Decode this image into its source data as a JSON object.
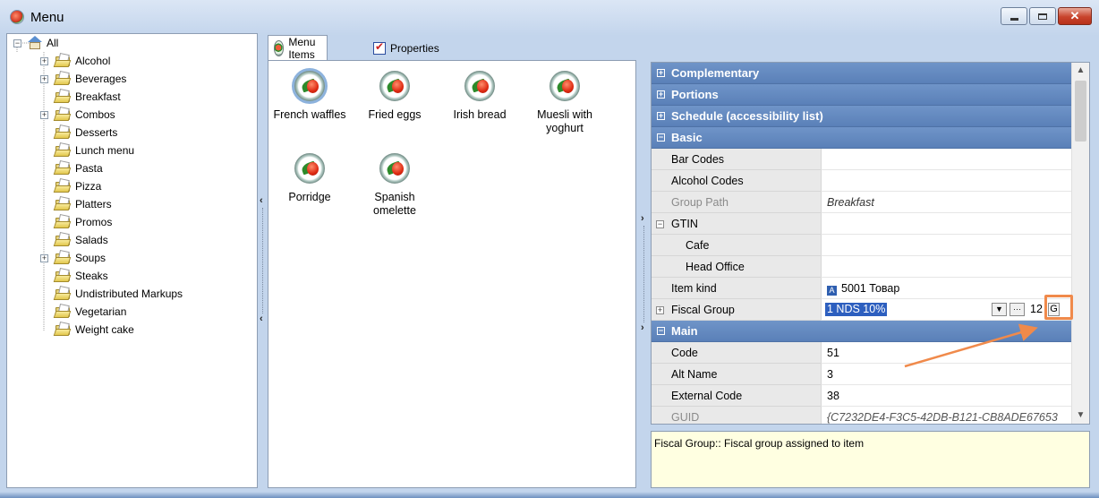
{
  "window": {
    "title": "Menu",
    "close_glyph": "✕"
  },
  "tree": {
    "root": "All",
    "items": [
      {
        "label": "Alcohol",
        "expandable": true
      },
      {
        "label": "Beverages",
        "expandable": true
      },
      {
        "label": "Breakfast",
        "expandable": false
      },
      {
        "label": "Combos",
        "expandable": true
      },
      {
        "label": "Desserts",
        "expandable": false
      },
      {
        "label": "Lunch menu",
        "expandable": false
      },
      {
        "label": "Pasta",
        "expandable": false
      },
      {
        "label": "Pizza",
        "expandable": false
      },
      {
        "label": "Platters",
        "expandable": false
      },
      {
        "label": "Promos",
        "expandable": false
      },
      {
        "label": "Salads",
        "expandable": false
      },
      {
        "label": "Soups",
        "expandable": true
      },
      {
        "label": "Steaks",
        "expandable": false
      },
      {
        "label": "Undistributed Markups",
        "expandable": false
      },
      {
        "label": "Vegetarian",
        "expandable": false
      },
      {
        "label": "Weight cake",
        "expandable": false
      }
    ]
  },
  "tabs": {
    "menu_items": "Menu Items",
    "properties": "Properties"
  },
  "menu_items": [
    {
      "label": "French waffles"
    },
    {
      "label": "Fried eggs"
    },
    {
      "label": "Irish bread"
    },
    {
      "label": "Muesli with\nyoghurt"
    },
    {
      "label": "Porridge"
    },
    {
      "label": "Spanish\nomelette"
    }
  ],
  "splitter": {
    "collapse_left": "‹",
    "expand_right": "›"
  },
  "properties": {
    "categories_collapsed": [
      "Complementary",
      "Portions",
      "Schedule (accessibility list)"
    ],
    "basic": {
      "label": "Basic",
      "bar_codes": "Bar Codes",
      "alcohol_codes": "Alcohol Codes",
      "group_path": "Group Path",
      "group_path_value": "Breakfast",
      "gtin": "GTIN",
      "cafe": "Cafe",
      "head_office": "Head Office",
      "item_kind": "Item kind",
      "item_kind_badge": "A",
      "item_kind_value": "5001 Товар",
      "fiscal_group": "Fiscal Group",
      "fiscal_group_value": "1 NDS 10%",
      "fiscal_number": "12",
      "fiscal_g_button": "G",
      "ellipsis": "···",
      "dropdown_glyph": "▼"
    },
    "main": {
      "label": "Main",
      "code": "Code",
      "code_value": "51",
      "alt_name": "Alt Name",
      "alt_name_value": "3",
      "external_code": "External Code",
      "external_code_value": "38",
      "guid": "GUID",
      "guid_value": "{C7232DE4-F3C5-42DB-B121-CB8ADE67653"
    },
    "toggle_expand": "+",
    "toggle_collapse": "−"
  },
  "description": "Fiscal Group:: Fiscal group assigned to item",
  "colors": {
    "category_header": "#5f86bd",
    "selection": "#2d5fbf",
    "highlight": "#f08a4b",
    "description_bg": "#ffffe1"
  }
}
